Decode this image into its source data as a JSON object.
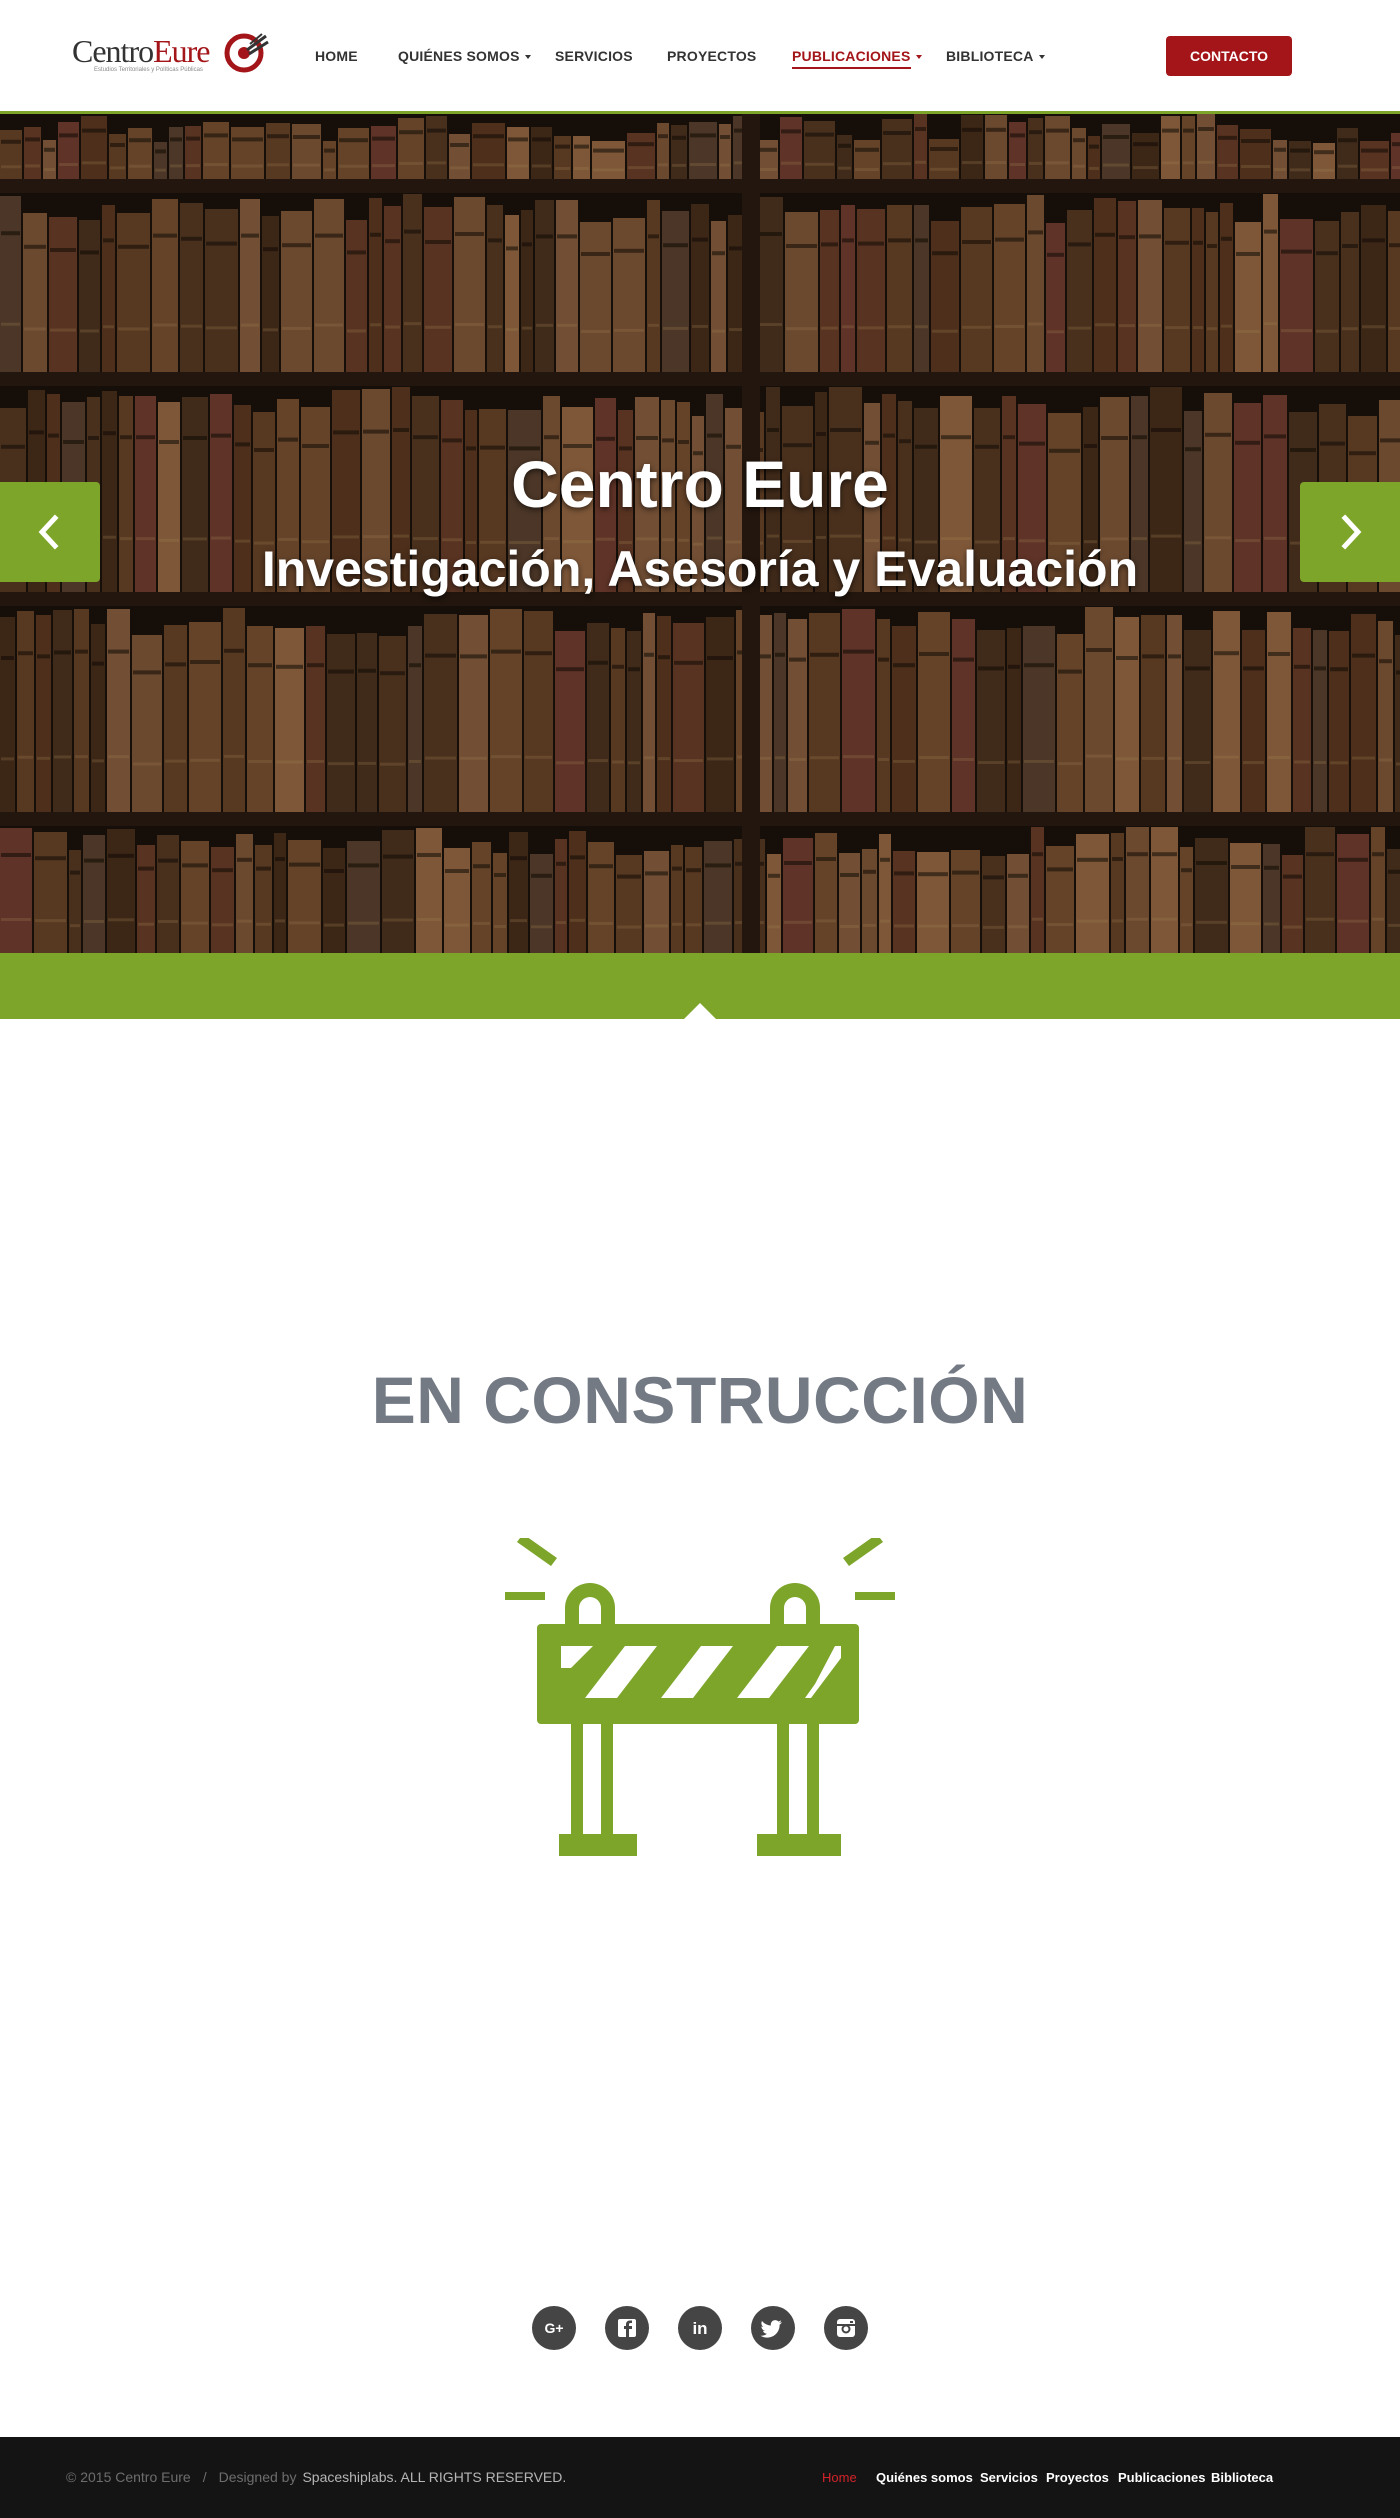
{
  "colors": {
    "accent_green": "#7ca52a",
    "brand_red": "#a31519",
    "heading_gray": "#737a84",
    "footer_bg": "#141414",
    "social_bg": "#454545"
  },
  "logo": {
    "word_part1": "Centro",
    "word_part2": "Eure",
    "tagline": "Estudios Territoriales y Políticas Públicas"
  },
  "nav": {
    "items": [
      {
        "label": "HOME",
        "has_dropdown": false,
        "active": false
      },
      {
        "label": "QUIÉNES SOMOS",
        "has_dropdown": true,
        "active": false
      },
      {
        "label": "SERVICIOS",
        "has_dropdown": false,
        "active": false
      },
      {
        "label": "PROYECTOS",
        "has_dropdown": false,
        "active": false
      },
      {
        "label": "PUBLICACIONES",
        "has_dropdown": true,
        "active": true
      },
      {
        "label": "BIBLIOTECA",
        "has_dropdown": true,
        "active": false
      }
    ],
    "contact_label": "CONTACTO"
  },
  "hero": {
    "title": "Centro Eure",
    "subtitle": "Investigación, Asesoría y Evaluación",
    "background": "bookshelf-photo",
    "prev_icon": "chevron-left-icon",
    "next_icon": "chevron-right-icon"
  },
  "main": {
    "heading": "EN CONSTRUCCIÓN",
    "illustration": "road-barrier-icon"
  },
  "social": [
    {
      "name": "google-plus-icon",
      "glyph": "G+"
    },
    {
      "name": "facebook-icon",
      "glyph": "f"
    },
    {
      "name": "linkedin-icon",
      "glyph": "in"
    },
    {
      "name": "twitter-icon",
      "glyph": "bird"
    },
    {
      "name": "instagram-icon",
      "glyph": "camera"
    }
  ],
  "footer": {
    "copyright": "© 2015 Centro Eure",
    "separator": "/",
    "designed_by": "Designed by",
    "designer": "Spaceshiplabs. ALL RIGHTS RESERVED.",
    "links": [
      {
        "label": "Home",
        "active": true
      },
      {
        "label": "Quiénes somos",
        "active": false
      },
      {
        "label": "Servicios",
        "active": false
      },
      {
        "label": "Proyectos",
        "active": false
      },
      {
        "label": "Publicaciones",
        "active": false
      },
      {
        "label": "Biblioteca",
        "active": false
      }
    ]
  }
}
